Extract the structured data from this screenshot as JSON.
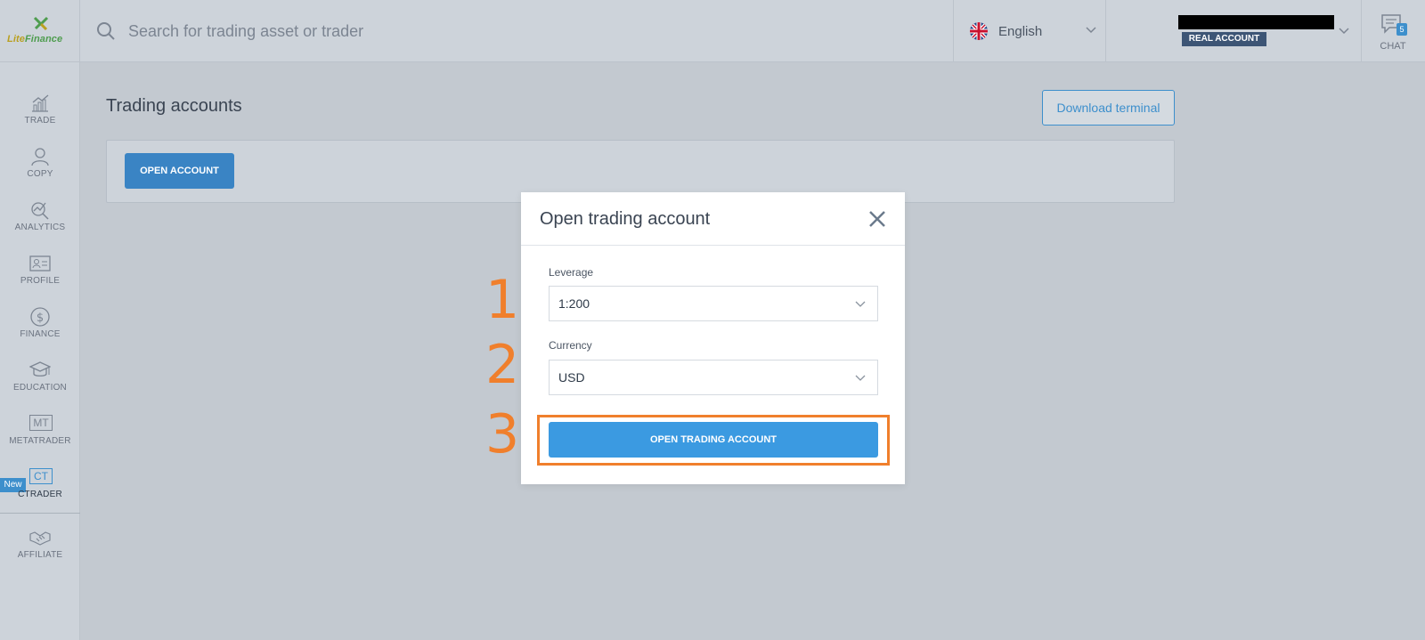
{
  "header": {
    "logo": {
      "text_part1": "Lite",
      "text_part2": "Finance"
    },
    "search_placeholder": "Search for trading asset or trader",
    "language": "English",
    "account_badge": "REAL ACCOUNT",
    "chat": {
      "label": "CHAT",
      "count": "5"
    }
  },
  "sidebar": {
    "items": [
      {
        "label": "TRADE",
        "icon": "chart-icon"
      },
      {
        "label": "COPY",
        "icon": "user-icon"
      },
      {
        "label": "ANALYTICS",
        "icon": "analytics-icon"
      },
      {
        "label": "PROFILE",
        "icon": "id-card-icon"
      },
      {
        "label": "FINANCE",
        "icon": "dollar-icon"
      },
      {
        "label": "EDUCATION",
        "icon": "graduation-cap-icon"
      },
      {
        "label": "METATRADER",
        "icon_text": "MT"
      },
      {
        "label": "CTRADER",
        "icon_text": "CT",
        "badge": "New"
      },
      {
        "label": "AFFILIATE",
        "icon": "handshake-icon"
      }
    ]
  },
  "main": {
    "title": "Trading accounts",
    "download_button": "Download terminal",
    "open_account_button": "OPEN ACCOUNT"
  },
  "modal": {
    "title": "Open trading account",
    "leverage_label": "Leverage",
    "leverage_value": "1:200",
    "currency_label": "Currency",
    "currency_value": "USD",
    "submit_button": "OPEN TRADING ACCOUNT"
  },
  "annotations": {
    "step1": "1",
    "step2": "2",
    "step3": "3"
  },
  "colors": {
    "accent": "#3b9ae1",
    "highlight": "#f07f2c",
    "badge": "#3d5575"
  }
}
